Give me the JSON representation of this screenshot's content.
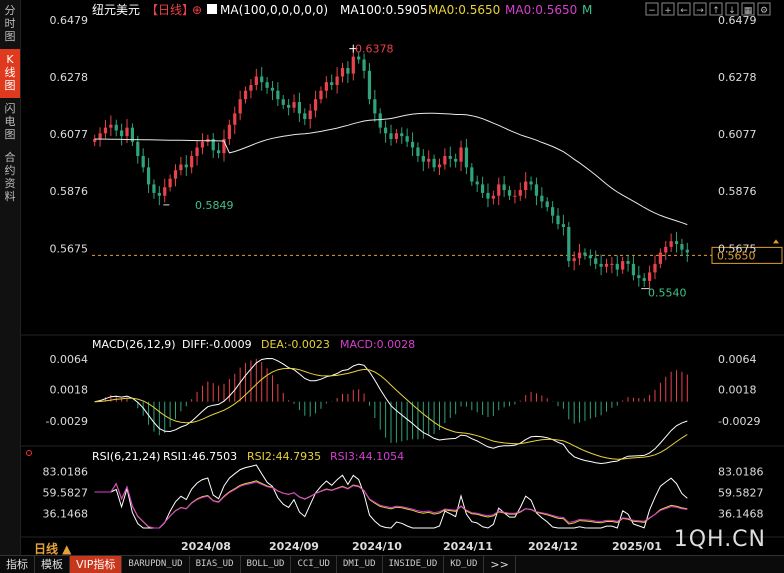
{
  "sidebar": {
    "tabs": [
      {
        "label": "分时图",
        "active": false
      },
      {
        "label": "K线图",
        "active": true
      },
      {
        "label": "闪电图",
        "active": false
      },
      {
        "label": "合约资料",
        "active": false
      }
    ]
  },
  "header": {
    "symbol": "纽元美元",
    "period": "【日线】",
    "plus_icon": "⊕",
    "ma_setting": "MA(100,0,0,0,0,0)",
    "ma100": "MA100:0.5905",
    "ma0a": "MA0:0.5650",
    "ma0b": "MA0:0.5650",
    "m": "M"
  },
  "toolbar_icons": [
    "minus-square-icon",
    "plus-square-icon",
    "left-arrow-icon",
    "right-arrow-icon",
    "up-arrow-icon",
    "down-arrow-icon",
    "grid-icon",
    "settings-icon"
  ],
  "main_panel": {
    "price_ticks": [
      "0.6479",
      "0.6278",
      "0.6077",
      "0.5876",
      "0.5675"
    ],
    "current_price": "0.5650",
    "high_label": "0.6378",
    "low_label_1": "0.5849",
    "low_label_2": "0.5540"
  },
  "macd_panel": {
    "title": "MACD(26,12,9)",
    "diff": "DIFF:-0.0009",
    "dea": "DEA:-0.0023",
    "macd": "MACD:0.0028",
    "ticks": [
      "0.0064",
      "0.0018",
      "-0.0029"
    ]
  },
  "rsi_panel": {
    "title": "RSI(6,21,24)",
    "rsi1": "RSI1:46.7503",
    "rsi2": "RSI2:44.7935",
    "rsi3": "RSI3:44.1054",
    "ticks": [
      "83.0186",
      "59.5827",
      "36.1468"
    ]
  },
  "x_axis": {
    "labels": [
      "2024/08",
      "2024/09",
      "2024/10",
      "2024/11",
      "2024/12",
      "2025/01"
    ]
  },
  "period_selector": "日线 ▲",
  "bottom_tabs": [
    {
      "label": "指标",
      "vip": false,
      "mono": false
    },
    {
      "label": "模板",
      "vip": false,
      "mono": false
    },
    {
      "label": "VIP指标",
      "vip": true,
      "mono": false
    },
    {
      "label": "BARUPDN_UD",
      "vip": false,
      "mono": true
    },
    {
      "label": "BIAS_UD",
      "vip": false,
      "mono": true
    },
    {
      "label": "BOLL_UD",
      "vip": false,
      "mono": true
    },
    {
      "label": "CCI_UD",
      "vip": false,
      "mono": true
    },
    {
      "label": "DMI_UD",
      "vip": false,
      "mono": true
    },
    {
      "label": "INSIDE_UD",
      "vip": false,
      "mono": true
    },
    {
      "label": "KD_UD",
      "vip": false,
      "mono": true
    },
    {
      "label": ">>",
      "vip": false,
      "mono": false
    }
  ],
  "watermark": "1QH.CN",
  "colors": {
    "up": "#e8424a",
    "down": "#2fa37a",
    "ma100": "#e8e8e8",
    "dashed": "#e0a030",
    "diff": "#ffffff",
    "dea": "#e8d23a",
    "macd_label": "#d63fd1",
    "rsi1": "#ffffff",
    "rsi2": "#e8d23a",
    "rsi3": "#d63fd1",
    "current_price": "#e0a030"
  },
  "chart_data": {
    "type": "candlestick",
    "price_range": [
      0.544,
      0.6479
    ],
    "closes": [
      0.606,
      0.608,
      0.61,
      0.611,
      0.609,
      0.607,
      0.61,
      0.605,
      0.6,
      0.596,
      0.59,
      0.587,
      0.586,
      0.589,
      0.592,
      0.595,
      0.597,
      0.596,
      0.6,
      0.603,
      0.605,
      0.606,
      0.602,
      0.601,
      0.606,
      0.611,
      0.615,
      0.62,
      0.623,
      0.625,
      0.628,
      0.626,
      0.624,
      0.623,
      0.62,
      0.618,
      0.617,
      0.619,
      0.615,
      0.613,
      0.616,
      0.62,
      0.623,
      0.626,
      0.625,
      0.628,
      0.631,
      0.629,
      0.635,
      0.634,
      0.63,
      0.62,
      0.615,
      0.61,
      0.608,
      0.606,
      0.608,
      0.607,
      0.605,
      0.603,
      0.6,
      0.598,
      0.599,
      0.596,
      0.597,
      0.6,
      0.599,
      0.598,
      0.603,
      0.596,
      0.591,
      0.59,
      0.587,
      0.585,
      0.586,
      0.59,
      0.588,
      0.586,
      0.586,
      0.588,
      0.591,
      0.59,
      0.586,
      0.584,
      0.582,
      0.579,
      0.576,
      0.575,
      0.563,
      0.564,
      0.566,
      0.565,
      0.564,
      0.562,
      0.561,
      0.562,
      0.562,
      0.56,
      0.563,
      0.562,
      0.558,
      0.557,
      0.556,
      0.559,
      0.562,
      0.566,
      0.568,
      0.57,
      0.569,
      0.567,
      0.566
    ],
    "ma100_y": "MA100 curve",
    "markers": {
      "high": 0.6378,
      "low_aug": 0.5849,
      "low_jan": 0.554
    },
    "current_price": 0.565
  }
}
